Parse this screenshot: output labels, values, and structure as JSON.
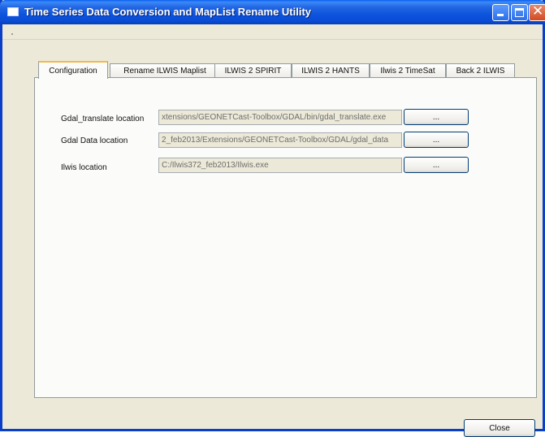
{
  "window": {
    "title": "Time Series Data Conversion and MapList Rename Utility",
    "controls": {
      "minimize": "minimize-icon",
      "maximize": "maximize-icon",
      "close": "close-icon"
    }
  },
  "tabs": [
    {
      "label": "Configuration",
      "active": true
    },
    {
      "label": "Rename ILWIS Maplist",
      "active": false
    },
    {
      "label": "ILWIS 2 SPIRIT",
      "active": false
    },
    {
      "label": "ILWIS 2 HANTS",
      "active": false
    },
    {
      "label": "Ilwis 2 TimeSat",
      "active": false
    },
    {
      "label": "Back 2 ILWIS",
      "active": false
    }
  ],
  "config": {
    "rows": [
      {
        "label": "Gdal_translate location",
        "value": "xtensions/GEONETCast-Toolbox/GDAL/bin/gdal_translate.exe",
        "button": "..."
      },
      {
        "label": "Gdal Data location",
        "value": "2_feb2013/Extensions/GEONETCast-Toolbox/GDAL/gdal_data",
        "button": "..."
      },
      {
        "label": "Ilwis location",
        "value": "C:/Ilwis372_feb2013/Ilwis.exe",
        "button": "..."
      }
    ]
  },
  "footer": {
    "close_label": "Close"
  },
  "colors": {
    "titlebar": "#0a4cd6",
    "tab_highlight": "#f5b84a",
    "dialog_bg": "#ece9d8",
    "panel_bg": "#fbfbf9"
  }
}
